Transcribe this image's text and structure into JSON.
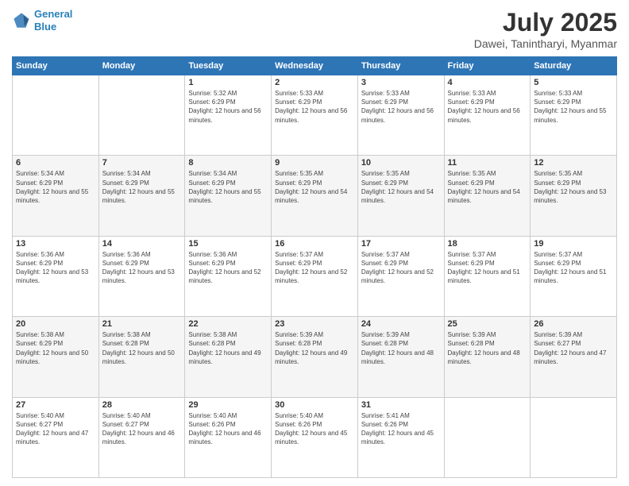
{
  "header": {
    "logo": {
      "line1": "General",
      "line2": "Blue"
    },
    "month": "July 2025",
    "location": "Dawei, Tanintharyi, Myanmar"
  },
  "weekdays": [
    "Sunday",
    "Monday",
    "Tuesday",
    "Wednesday",
    "Thursday",
    "Friday",
    "Saturday"
  ],
  "weeks": [
    [
      {
        "day": "",
        "info": ""
      },
      {
        "day": "",
        "info": ""
      },
      {
        "day": "1",
        "info": "Sunrise: 5:32 AM\nSunset: 6:29 PM\nDaylight: 12 hours and 56 minutes."
      },
      {
        "day": "2",
        "info": "Sunrise: 5:33 AM\nSunset: 6:29 PM\nDaylight: 12 hours and 56 minutes."
      },
      {
        "day": "3",
        "info": "Sunrise: 5:33 AM\nSunset: 6:29 PM\nDaylight: 12 hours and 56 minutes."
      },
      {
        "day": "4",
        "info": "Sunrise: 5:33 AM\nSunset: 6:29 PM\nDaylight: 12 hours and 56 minutes."
      },
      {
        "day": "5",
        "info": "Sunrise: 5:33 AM\nSunset: 6:29 PM\nDaylight: 12 hours and 55 minutes."
      }
    ],
    [
      {
        "day": "6",
        "info": "Sunrise: 5:34 AM\nSunset: 6:29 PM\nDaylight: 12 hours and 55 minutes."
      },
      {
        "day": "7",
        "info": "Sunrise: 5:34 AM\nSunset: 6:29 PM\nDaylight: 12 hours and 55 minutes."
      },
      {
        "day": "8",
        "info": "Sunrise: 5:34 AM\nSunset: 6:29 PM\nDaylight: 12 hours and 55 minutes."
      },
      {
        "day": "9",
        "info": "Sunrise: 5:35 AM\nSunset: 6:29 PM\nDaylight: 12 hours and 54 minutes."
      },
      {
        "day": "10",
        "info": "Sunrise: 5:35 AM\nSunset: 6:29 PM\nDaylight: 12 hours and 54 minutes."
      },
      {
        "day": "11",
        "info": "Sunrise: 5:35 AM\nSunset: 6:29 PM\nDaylight: 12 hours and 54 minutes."
      },
      {
        "day": "12",
        "info": "Sunrise: 5:35 AM\nSunset: 6:29 PM\nDaylight: 12 hours and 53 minutes."
      }
    ],
    [
      {
        "day": "13",
        "info": "Sunrise: 5:36 AM\nSunset: 6:29 PM\nDaylight: 12 hours and 53 minutes."
      },
      {
        "day": "14",
        "info": "Sunrise: 5:36 AM\nSunset: 6:29 PM\nDaylight: 12 hours and 53 minutes."
      },
      {
        "day": "15",
        "info": "Sunrise: 5:36 AM\nSunset: 6:29 PM\nDaylight: 12 hours and 52 minutes."
      },
      {
        "day": "16",
        "info": "Sunrise: 5:37 AM\nSunset: 6:29 PM\nDaylight: 12 hours and 52 minutes."
      },
      {
        "day": "17",
        "info": "Sunrise: 5:37 AM\nSunset: 6:29 PM\nDaylight: 12 hours and 52 minutes."
      },
      {
        "day": "18",
        "info": "Sunrise: 5:37 AM\nSunset: 6:29 PM\nDaylight: 12 hours and 51 minutes."
      },
      {
        "day": "19",
        "info": "Sunrise: 5:37 AM\nSunset: 6:29 PM\nDaylight: 12 hours and 51 minutes."
      }
    ],
    [
      {
        "day": "20",
        "info": "Sunrise: 5:38 AM\nSunset: 6:29 PM\nDaylight: 12 hours and 50 minutes."
      },
      {
        "day": "21",
        "info": "Sunrise: 5:38 AM\nSunset: 6:28 PM\nDaylight: 12 hours and 50 minutes."
      },
      {
        "day": "22",
        "info": "Sunrise: 5:38 AM\nSunset: 6:28 PM\nDaylight: 12 hours and 49 minutes."
      },
      {
        "day": "23",
        "info": "Sunrise: 5:39 AM\nSunset: 6:28 PM\nDaylight: 12 hours and 49 minutes."
      },
      {
        "day": "24",
        "info": "Sunrise: 5:39 AM\nSunset: 6:28 PM\nDaylight: 12 hours and 48 minutes."
      },
      {
        "day": "25",
        "info": "Sunrise: 5:39 AM\nSunset: 6:28 PM\nDaylight: 12 hours and 48 minutes."
      },
      {
        "day": "26",
        "info": "Sunrise: 5:39 AM\nSunset: 6:27 PM\nDaylight: 12 hours and 47 minutes."
      }
    ],
    [
      {
        "day": "27",
        "info": "Sunrise: 5:40 AM\nSunset: 6:27 PM\nDaylight: 12 hours and 47 minutes."
      },
      {
        "day": "28",
        "info": "Sunrise: 5:40 AM\nSunset: 6:27 PM\nDaylight: 12 hours and 46 minutes."
      },
      {
        "day": "29",
        "info": "Sunrise: 5:40 AM\nSunset: 6:26 PM\nDaylight: 12 hours and 46 minutes."
      },
      {
        "day": "30",
        "info": "Sunrise: 5:40 AM\nSunset: 6:26 PM\nDaylight: 12 hours and 45 minutes."
      },
      {
        "day": "31",
        "info": "Sunrise: 5:41 AM\nSunset: 6:26 PM\nDaylight: 12 hours and 45 minutes."
      },
      {
        "day": "",
        "info": ""
      },
      {
        "day": "",
        "info": ""
      }
    ]
  ]
}
